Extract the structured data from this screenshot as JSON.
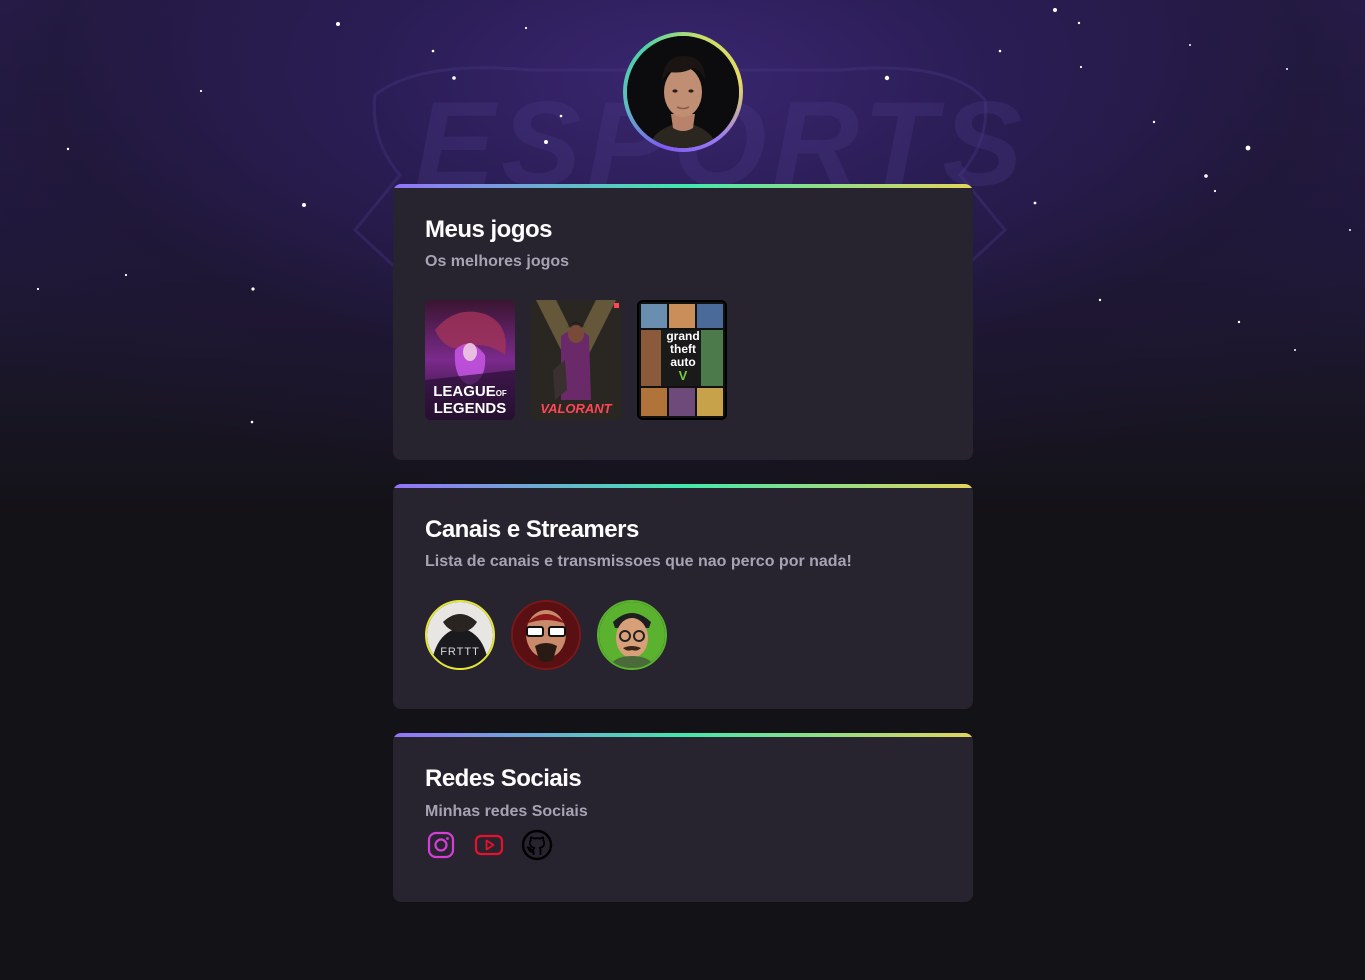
{
  "profile": {
    "avatar_alt": "Foto de perfil"
  },
  "games_card": {
    "title": "Meus jogos",
    "subtitle": "Os melhores jogos",
    "games": [
      {
        "label_line1": "LEAGUE",
        "label_of": "OF",
        "label_line2": "LEGENDS"
      },
      {
        "label": "VALORANT"
      },
      {
        "label_line1": "grand",
        "label_line2": "theft",
        "label_line3": "auto",
        "label_line4": "V"
      }
    ]
  },
  "channels_card": {
    "title": "Canais e Streamers",
    "subtitle": "Lista de canais e transmissoes que nao perco por nada!",
    "channels": [
      {
        "shirt_text": "FRTTT",
        "ring_color": "#e6e635"
      },
      {
        "ring_color": "#7a1717"
      },
      {
        "ring_color": "#5ab22e"
      }
    ]
  },
  "social_card": {
    "title": "Redes Sociais",
    "subtitle": "Minhas redes Sociais",
    "links": [
      {
        "icon": "instagram-icon",
        "color": "#d63fd6"
      },
      {
        "icon": "youtube-icon",
        "color": "#e8102a"
      },
      {
        "icon": "github-icon",
        "color": "#000000"
      }
    ]
  },
  "colors": {
    "page_bg": "#131216",
    "card_bg": "#27232f",
    "gradient_start": "#9572fc",
    "gradient_mid": "#43e7ad",
    "gradient_end": "#e2d45c",
    "subtitle": "#a8a3b3"
  }
}
